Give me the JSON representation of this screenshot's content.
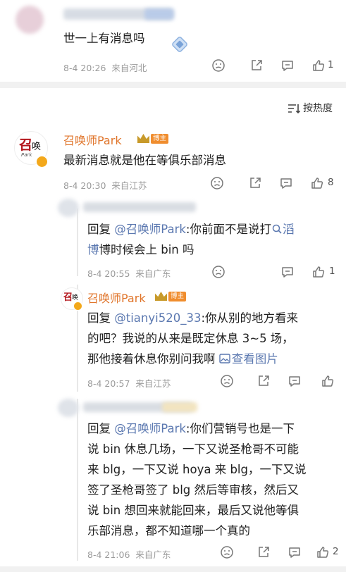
{
  "top_comment": {
    "text": "世一上有消息吗",
    "time": "8-4 20:26",
    "location": "来自河北",
    "likes": "1"
  },
  "sort": {
    "label": "按热度"
  },
  "comment": {
    "username": "召唤师Park",
    "role_badge": "博主",
    "avatar_text": "召",
    "avatar_sub": "唤",
    "avatar_park": "Park",
    "text": "最新消息就是他在等俱乐部消息",
    "time": "8-4 20:30",
    "location": "来自江苏",
    "likes": "8"
  },
  "replies": [
    {
      "prefix": "回复 ",
      "mention": "@召唤师Park",
      "text_a": ":你前面不是说打",
      "search_link": "滔",
      "text_b": "博时候会上 bin 吗",
      "time": "8-4 20:55",
      "location": "来自广东",
      "likes": "1"
    },
    {
      "username": "召唤师Park",
      "role_badge": "博主",
      "prefix": "回复 ",
      "mention": "@tianyi520_33",
      "line1": ":你从别的地方看来",
      "line2": "的吧？我说的从来是既定休息 3~5 场，",
      "line3": "那他接着休息你别问我啊 ",
      "view_image": "查看图片",
      "time": "8-4 20:57",
      "location": "来自江苏",
      "likes": ""
    },
    {
      "prefix": "回复 ",
      "mention": "@召唤师Park",
      "line1": ":你们营销号也是一下",
      "line2": "说 bin 休息几场，一下又说圣枪哥不可能",
      "line3": "来 blg，一下又说 hoya 来 blg，一下又说",
      "line4": "签了圣枪哥签了 blg 然后等审核，然后又",
      "line5": "说 bin 想回来就能回来，最后又说他等俱",
      "line6": "乐部消息，都不知道哪一个真的",
      "time": "8-4 21:06",
      "location": "来自广东",
      "likes": "2"
    }
  ],
  "colors": {
    "accent": "#e0752b",
    "link": "#5b78b0",
    "meta": "#9a9a9a"
  },
  "icons": [
    "sad-face-icon",
    "share-icon",
    "comment-icon",
    "like-icon",
    "sort-icon",
    "search-icon",
    "image-icon",
    "verified-badge-icon",
    "crown-icon"
  ]
}
